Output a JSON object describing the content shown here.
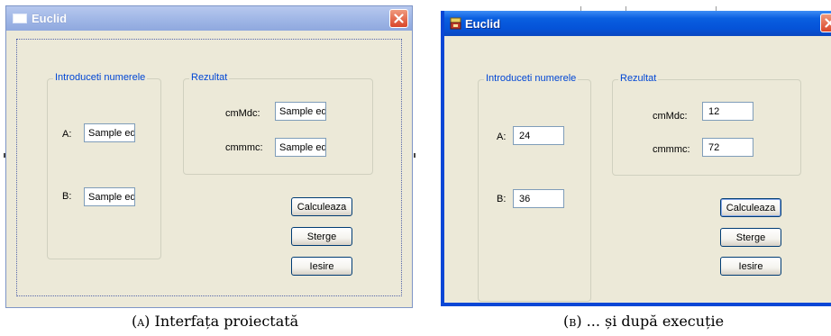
{
  "window_a": {
    "title": "Euclid",
    "group_numbers": {
      "legend": "Introduceti numerele",
      "label_a": "A:",
      "value_a": "Sample ed",
      "label_b": "B:",
      "value_b": "Sample ed"
    },
    "group_result": {
      "legend": "Rezultat",
      "label_cmmdc": "cmMdc:",
      "value_cmmdc": "Sample ed",
      "label_cmmmc": "cmmmc:",
      "value_cmmmc": "Sample ed"
    },
    "buttons": {
      "calculate": "Calculeaza",
      "clear": "Sterge",
      "exit": "Iesire"
    },
    "icon": "window-icon"
  },
  "window_b": {
    "title": "Euclid",
    "group_numbers": {
      "legend": "Introduceti numerele",
      "label_a": "A:",
      "value_a": "24",
      "label_b": "B:",
      "value_b": "36"
    },
    "group_result": {
      "legend": "Rezultat",
      "label_cmmdc": "cmMdc:",
      "value_cmmdc": "12",
      "label_cmmmc": "cmmmc:",
      "value_cmmmc": "72"
    },
    "buttons": {
      "calculate": "Calculeaza",
      "clear": "Sterge",
      "exit": "Iesire"
    },
    "icon": "app-icon"
  },
  "captions": {
    "a_marker": "(a)",
    "a_text": " Interfața proiectată",
    "b_marker": "(b)",
    "b_text": " ... și după execuție"
  },
  "colors": {
    "window_bg": "#ece9d8",
    "legend_text": "#0046d5",
    "titlebar_a": "#9fb6e6",
    "titlebar_b": "#0553d8",
    "close_button": "#d9462a"
  }
}
